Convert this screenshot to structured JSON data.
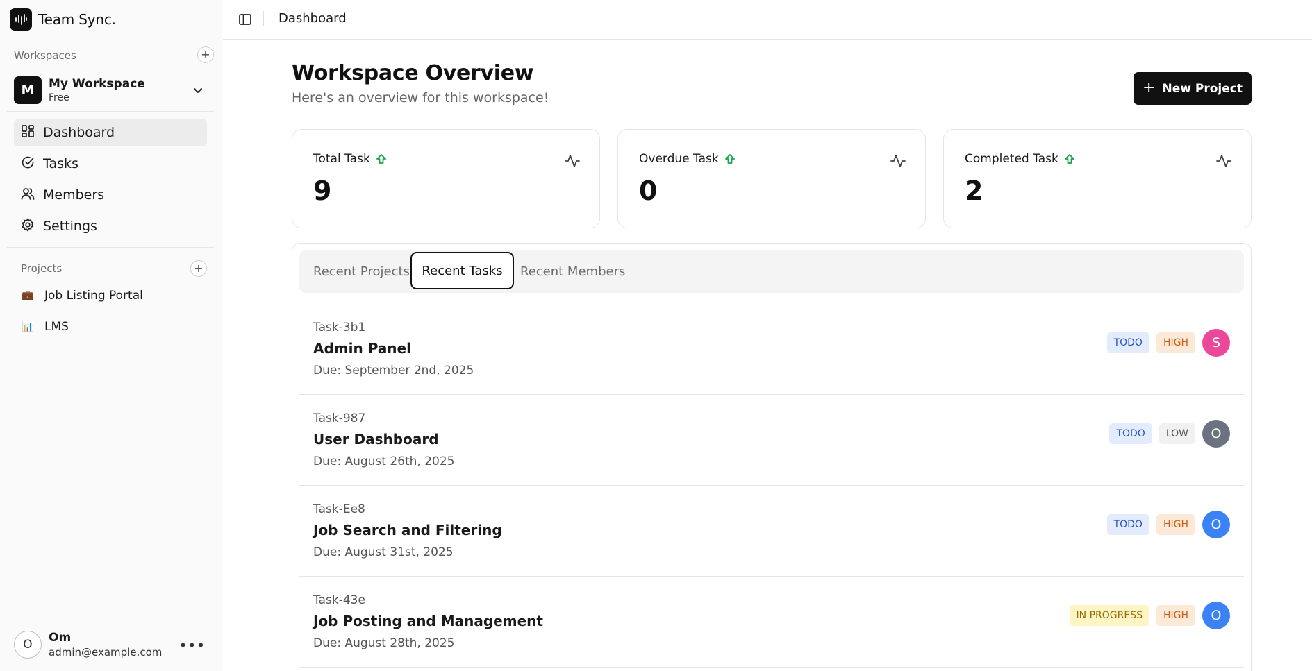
{
  "app": {
    "name": "Team Sync."
  },
  "sidebar": {
    "workspaces_label": "Workspaces",
    "workspace": {
      "initial": "M",
      "name": "My Workspace",
      "plan": "Free"
    },
    "nav": [
      {
        "label": "Dashboard",
        "icon": "dashboard-icon",
        "active": true
      },
      {
        "label": "Tasks",
        "icon": "check-circle-icon",
        "active": false
      },
      {
        "label": "Members",
        "icon": "users-icon",
        "active": false
      },
      {
        "label": "Settings",
        "icon": "gear-icon",
        "active": false
      }
    ],
    "projects_label": "Projects",
    "projects": [
      {
        "emoji": "💼",
        "label": "Job Listing Portal"
      },
      {
        "emoji": "📊",
        "label": "LMS"
      }
    ],
    "user": {
      "initial": "O",
      "name": "Om",
      "email": "admin@example.com"
    }
  },
  "topbar": {
    "breadcrumb": "Dashboard"
  },
  "main": {
    "title": "Workspace Overview",
    "subtitle": "Here's an overview for this workspace!",
    "new_project_label": "New Project",
    "stats": [
      {
        "label": "Total Task",
        "value": "9"
      },
      {
        "label": "Overdue Task",
        "value": "0"
      },
      {
        "label": "Completed Task",
        "value": "2"
      }
    ],
    "tabs": [
      {
        "label": "Recent Projects",
        "active": false
      },
      {
        "label": "Recent Tasks",
        "active": true
      },
      {
        "label": "Recent Members",
        "active": false
      }
    ],
    "tasks": [
      {
        "code": "Task-3b1",
        "title": "Admin Panel",
        "due": "Due: September 2nd, 2025",
        "status": "TODO",
        "priority": "HIGH",
        "assignee": "S",
        "assignee_color": "#ec4899"
      },
      {
        "code": "Task-987",
        "title": "User Dashboard",
        "due": "Due: August 26th, 2025",
        "status": "TODO",
        "priority": "LOW",
        "assignee": "O",
        "assignee_color": "#6b7280"
      },
      {
        "code": "Task-Ee8",
        "title": "Job Search and Filtering",
        "due": "Due: August 31st, 2025",
        "status": "TODO",
        "priority": "HIGH",
        "assignee": "O",
        "assignee_color": "#3b82f6"
      },
      {
        "code": "Task-43e",
        "title": "Job Posting and Management",
        "due": "Due: August 28th, 2025",
        "status": "IN PROGRESS",
        "priority": "HIGH",
        "assignee": "O",
        "assignee_color": "#3b82f6"
      }
    ]
  },
  "colors": {
    "primary": "#111111",
    "trend_up": "#16a34a"
  }
}
